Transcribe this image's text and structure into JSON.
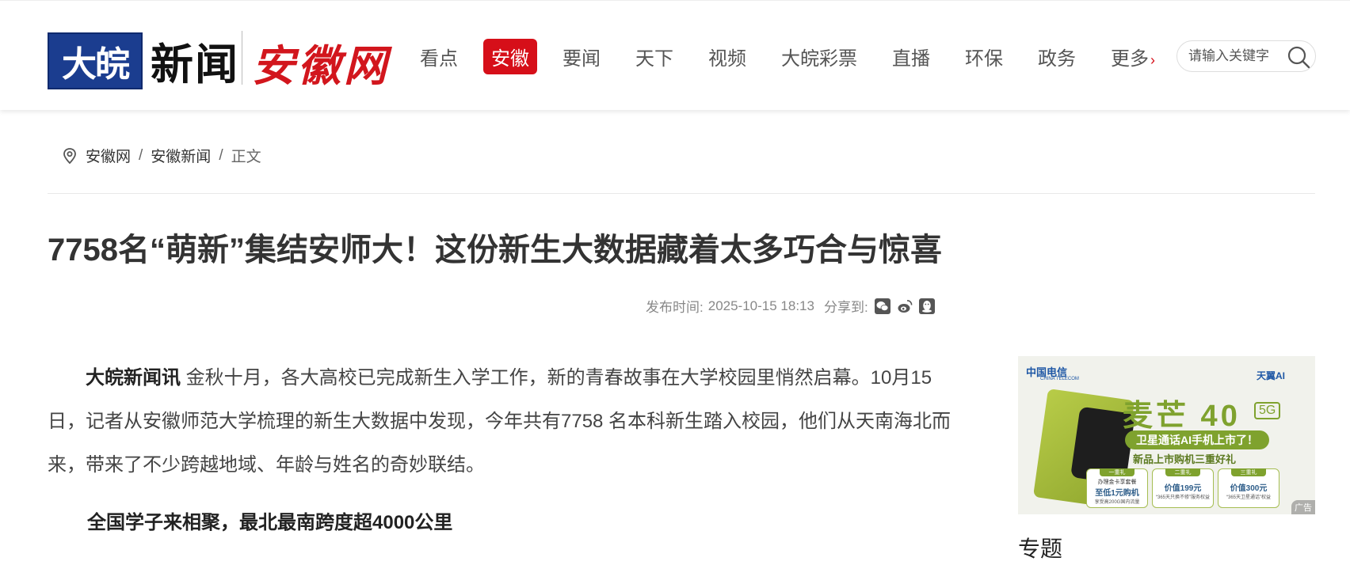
{
  "header": {
    "logo_dawan_box": "大皖",
    "logo_dawan_text": "新闻",
    "logo_anhuiwang": "安徽网",
    "nav": [
      {
        "label": "看点",
        "active": false
      },
      {
        "label": "安徽",
        "active": true
      },
      {
        "label": "要闻",
        "active": false
      },
      {
        "label": "天下",
        "active": false
      },
      {
        "label": "视频",
        "active": false
      },
      {
        "label": "大皖彩票",
        "active": false
      },
      {
        "label": "直播",
        "active": false
      },
      {
        "label": "环保",
        "active": false
      },
      {
        "label": "政务",
        "active": false
      }
    ],
    "more_label": "更多",
    "more_arrow": "›",
    "search_placeholder": "请输入关键字",
    "accent_color": "#d60f19"
  },
  "breadcrumb": {
    "items": [
      "安徽网",
      "安徽新闻"
    ],
    "separator": "/",
    "current": "正文"
  },
  "article": {
    "title": "7758名“萌新”集结安师大！这份新生大数据藏着太多巧合与惊喜",
    "publish_label": "发布时间:",
    "publish_time": "2025-10-15 18:13",
    "share_label": "分享到:",
    "share_icons": [
      "wechat-icon",
      "weibo-icon",
      "qq-icon"
    ],
    "lead_source": "大皖新闻讯",
    "lead_text": " 金秋十月，各大高校已完成新生入学工作，新的青春故事在大学校园里悄然启幕。10月15日，记者从安徽师范大学梳理的新生大数据中发现，今年共有7758 名本科新生踏入校园，他们从天南海北而来，带来了不少跨越地域、年龄与姓名的奇妙联结。",
    "subheading": "全国学子来相聚，最北最南跨度超4000公里"
  },
  "ad": {
    "telecom_name": "中国电信",
    "telecom_en": "CHINA TELECOM",
    "tianyi": "天翼AI",
    "product": "麦芒 40",
    "network": "5G",
    "banner": "卫星通话AI手机上市了！",
    "subtitle": "新品上市购机三重好礼",
    "gifts": [
      {
        "tag": "一重礼",
        "line1": "办理金卡享套餐",
        "line2": "至低1元购机",
        "line3": "享受高200G国内流量"
      },
      {
        "tag": "二重礼",
        "line1": "",
        "line2": "价值199元",
        "line3": "“365天只换不修”服务权益"
      },
      {
        "tag": "三重礼",
        "line1": "",
        "line2": "价值300元",
        "line3": "“365天卫星通话”权益"
      }
    ],
    "ad_label": "广告"
  },
  "sidebar": {
    "title": "专题"
  }
}
